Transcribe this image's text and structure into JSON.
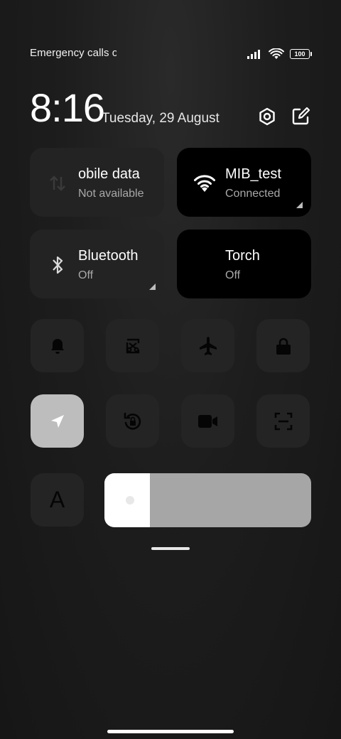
{
  "status_bar": {
    "left_text": "Emergency calls o",
    "battery": "100"
  },
  "header": {
    "time": "8:16",
    "date": "Tuesday, 29 August",
    "icons": [
      "settings-icon",
      "edit-icon"
    ]
  },
  "tiles": [
    {
      "title": "obile data",
      "subtitle": "Not available",
      "icon": "mobile-data-icon",
      "active": false
    },
    {
      "title": "MIB_test",
      "subtitle": "Connected",
      "icon": "wifi-icon",
      "active": true
    },
    {
      "title": "Bluetooth",
      "subtitle": "Off",
      "icon": "bluetooth-icon",
      "active": false
    },
    {
      "title": "Torch",
      "subtitle": "Off",
      "icon": "torch-icon",
      "active": true
    }
  ],
  "toggles_row1": [
    "bell-icon",
    "screenshot-icon",
    "airplane-icon",
    "lock-icon"
  ],
  "toggles_row2": [
    "location-icon",
    "rotation-lock-icon",
    "video-camera-icon",
    "scanner-icon"
  ],
  "location_on": true,
  "font_toggle_glyph": "A",
  "brightness": {
    "level_percent": 22
  },
  "colors": {
    "accent_on": "#bdbdbd",
    "tile_dark": "#000000",
    "tile_dim": "#232323"
  }
}
